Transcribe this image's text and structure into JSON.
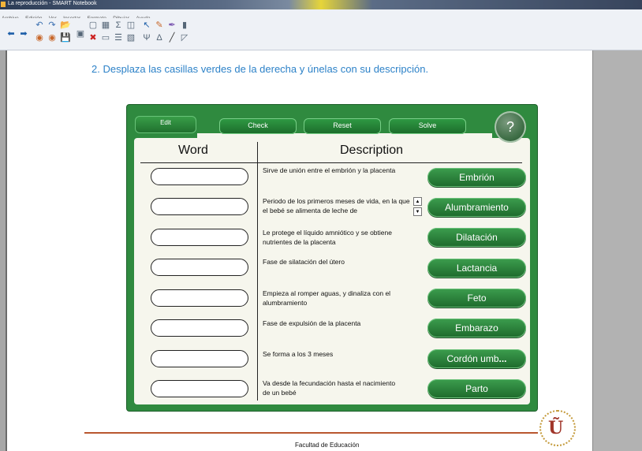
{
  "window": {
    "title": "La reproducción - SMART Notebook"
  },
  "menu": [
    "Archivo",
    "Edición",
    "Ver",
    "Insertar",
    "Formato",
    "Dibujar",
    "Ayuda"
  ],
  "toolbar": {
    "icons": [
      "back-arrow",
      "forward-arrow",
      "undo",
      "redo",
      "open-file",
      "save-file",
      "insert-gallery",
      "screen-shade",
      "delete",
      "table",
      "screen-capture",
      "select",
      "pen",
      "eraser",
      "fill",
      "line",
      "text",
      "shape"
    ]
  },
  "page": {
    "instruction": "2. Desplaza las casillas verdes de la derecha y únelas con su descripción.",
    "footer": "Facultad de Educación"
  },
  "activity": {
    "edit_label": "Edit",
    "check_label": "Check",
    "reset_label": "Reset",
    "solve_label": "Solve",
    "help_label": "?",
    "col_word": "Word",
    "col_description": "Description",
    "descriptions": [
      "Sirve de unión entre el embrión y la placenta",
      "Periodo de los primeros meses de vida, en la que el bebé se alimenta de leche de",
      "Le protege el líquido amniótico y se obtiene nutrientes de la placenta",
      "Fase de silatación del útero",
      "Empieza al romper aguas, y dinaliza con el alumbramiento",
      "Fase de expulsión de la placenta",
      "Se forma a los 3 meses",
      "Va desde la fecundación hasta el nacimiento de un bebé"
    ],
    "words": [
      "Embrión",
      "Alumbramiento",
      "Dilatación",
      "Lactancia",
      "Feto",
      "Embarazo",
      "Cordón umb",
      "Parto"
    ],
    "word_overflow": "..."
  },
  "colors": {
    "panel_green": "#2f8a3f",
    "instruction_blue": "#2d82c8",
    "footer_line": "#b9572f"
  }
}
